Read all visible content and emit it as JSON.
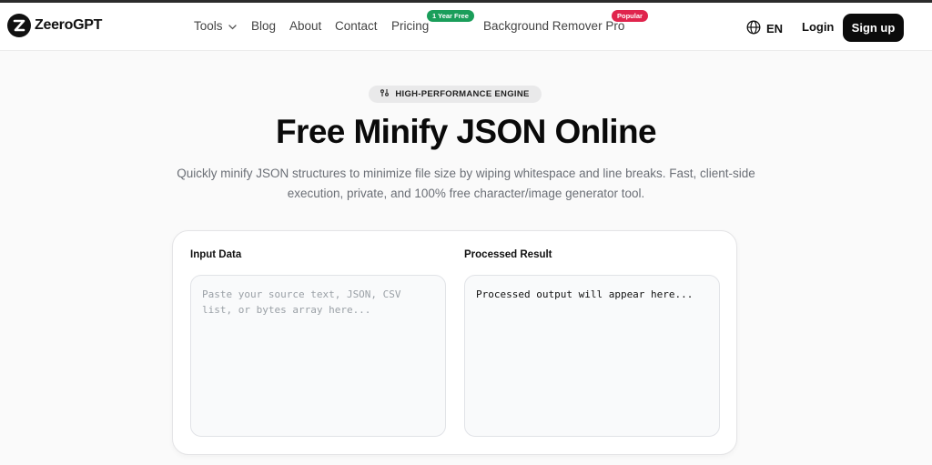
{
  "brand": {
    "name": "ZeeroGPT"
  },
  "nav": {
    "tools": "Tools",
    "blog": "Blog",
    "about": "About",
    "contact": "Contact",
    "pricing": "Pricing",
    "pricing_badge": "1 Year Free",
    "bg_remover": "Background Remover Pro",
    "bg_remover_badge": "Popular"
  },
  "header_actions": {
    "language": "EN",
    "login": "Login",
    "signup": "Sign up"
  },
  "hero": {
    "badge": "HIGH-PERFORMANCE ENGINE",
    "title": "Free Minify JSON Online",
    "subtitle_line1": "Quickly minify JSON structures to minimize file size by wiping whitespace and line breaks. Fast, client-side",
    "subtitle_line2": "execution, private, and 100% free character/image generator tool."
  },
  "tool": {
    "input_label": "Input Data",
    "input_placeholder": "Paste your source text, JSON, CSV list, or bytes array here...",
    "output_label": "Processed Result",
    "output_text": "Processed output will appear here..."
  },
  "colors": {
    "accent_green": "#1a9e5a",
    "accent_red": "#e0244d",
    "primary_button": "#0b0b0b"
  },
  "icons": {
    "logo": "zeerogpt-logo-icon",
    "dropdown": "chevron-down-icon",
    "language": "globe-icon",
    "engine": "sliders-icon"
  }
}
